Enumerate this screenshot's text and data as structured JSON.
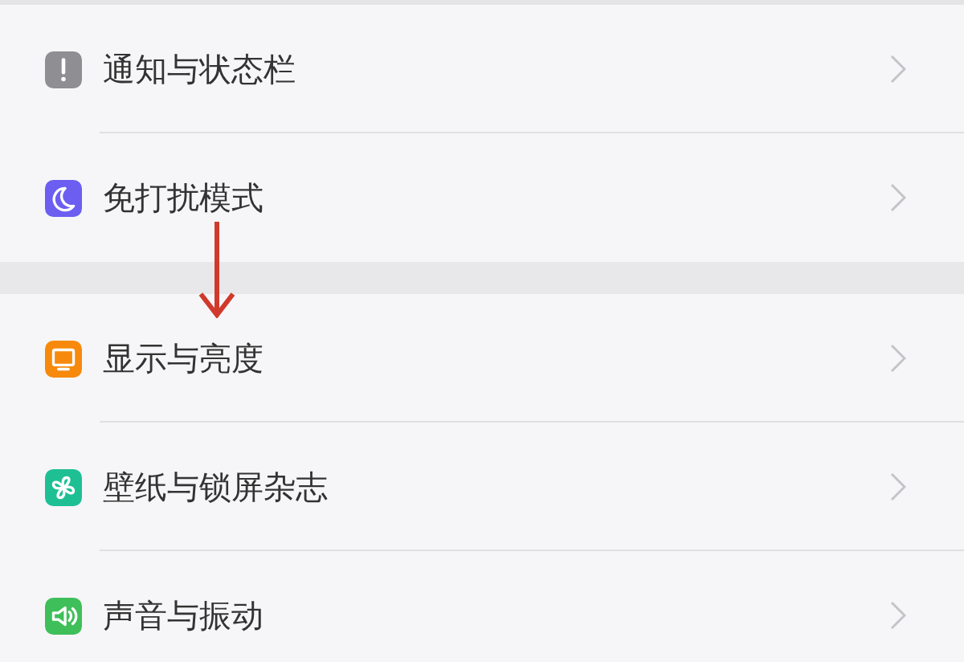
{
  "groups": [
    {
      "items": [
        {
          "label": "通知与状态栏",
          "kind": "alert",
          "color": "#8e8e93"
        },
        {
          "label": "免打扰模式",
          "kind": "moon",
          "color": "#6b5ef0"
        }
      ]
    },
    {
      "items": [
        {
          "label": "显示与亮度",
          "kind": "monitor",
          "color": "#f7890d"
        },
        {
          "label": "壁纸与锁屏杂志",
          "kind": "flower",
          "color": "#1fbf94"
        },
        {
          "label": "声音与振动",
          "kind": "speaker",
          "color": "#3fbf5a"
        }
      ]
    }
  ]
}
